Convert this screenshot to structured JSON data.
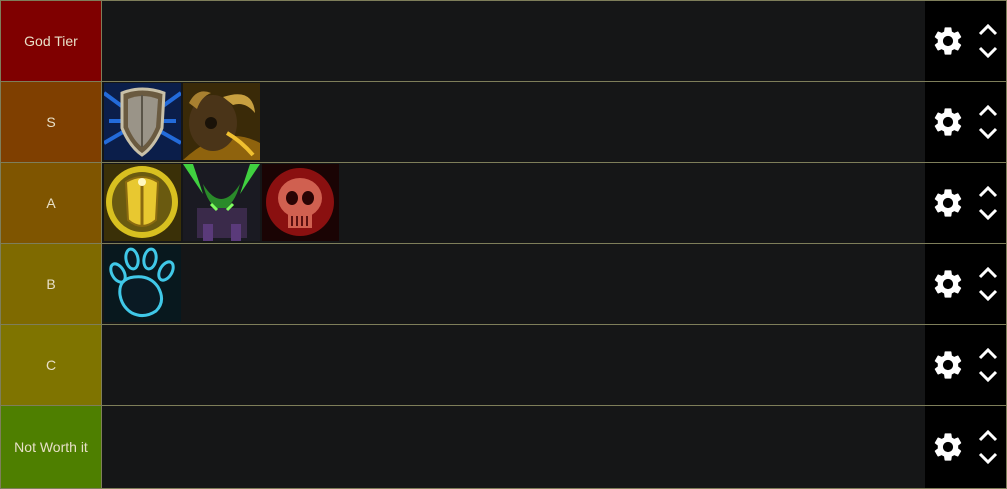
{
  "tiers": [
    {
      "label": "God Tier",
      "color": "#7f0000",
      "items": []
    },
    {
      "label": "S",
      "color": "#7f3f00",
      "items": [
        "shield-wall-icon",
        "bull-helm-icon"
      ]
    },
    {
      "label": "A",
      "color": "#7f5500",
      "items": [
        "golden-armor-icon",
        "demon-hunter-icon",
        "red-skull-icon"
      ]
    },
    {
      "label": "B",
      "color": "#7f6a00",
      "items": [
        "blue-paw-icon"
      ]
    },
    {
      "label": "C",
      "color": "#7f7400",
      "items": []
    },
    {
      "label": "Not Worth it",
      "color": "#4e7f00",
      "items": []
    }
  ],
  "controls": {
    "settings_icon": "gear-icon",
    "move_up_icon": "chevron-up-icon",
    "move_down_icon": "chevron-down-icon"
  }
}
